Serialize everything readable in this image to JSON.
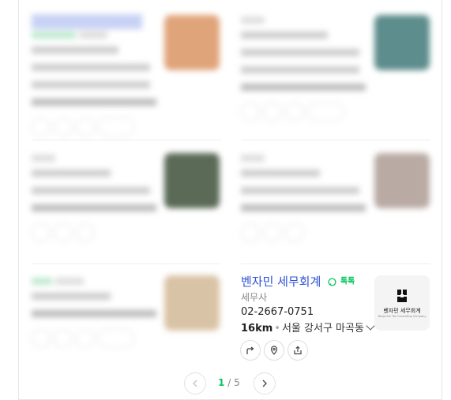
{
  "featured": {
    "name": "벤자민 세무회계",
    "talk_label": "톡톡",
    "category": "세무사",
    "phone": "02-2667-0751",
    "distance": "16km",
    "address": "서울 강서구 마곡동",
    "logo_text": "벤자민 세무회계",
    "logo_subtext": "Benjamin Tax Consulting Company"
  },
  "pagination": {
    "current": "1",
    "separator": "/",
    "total": "5"
  }
}
